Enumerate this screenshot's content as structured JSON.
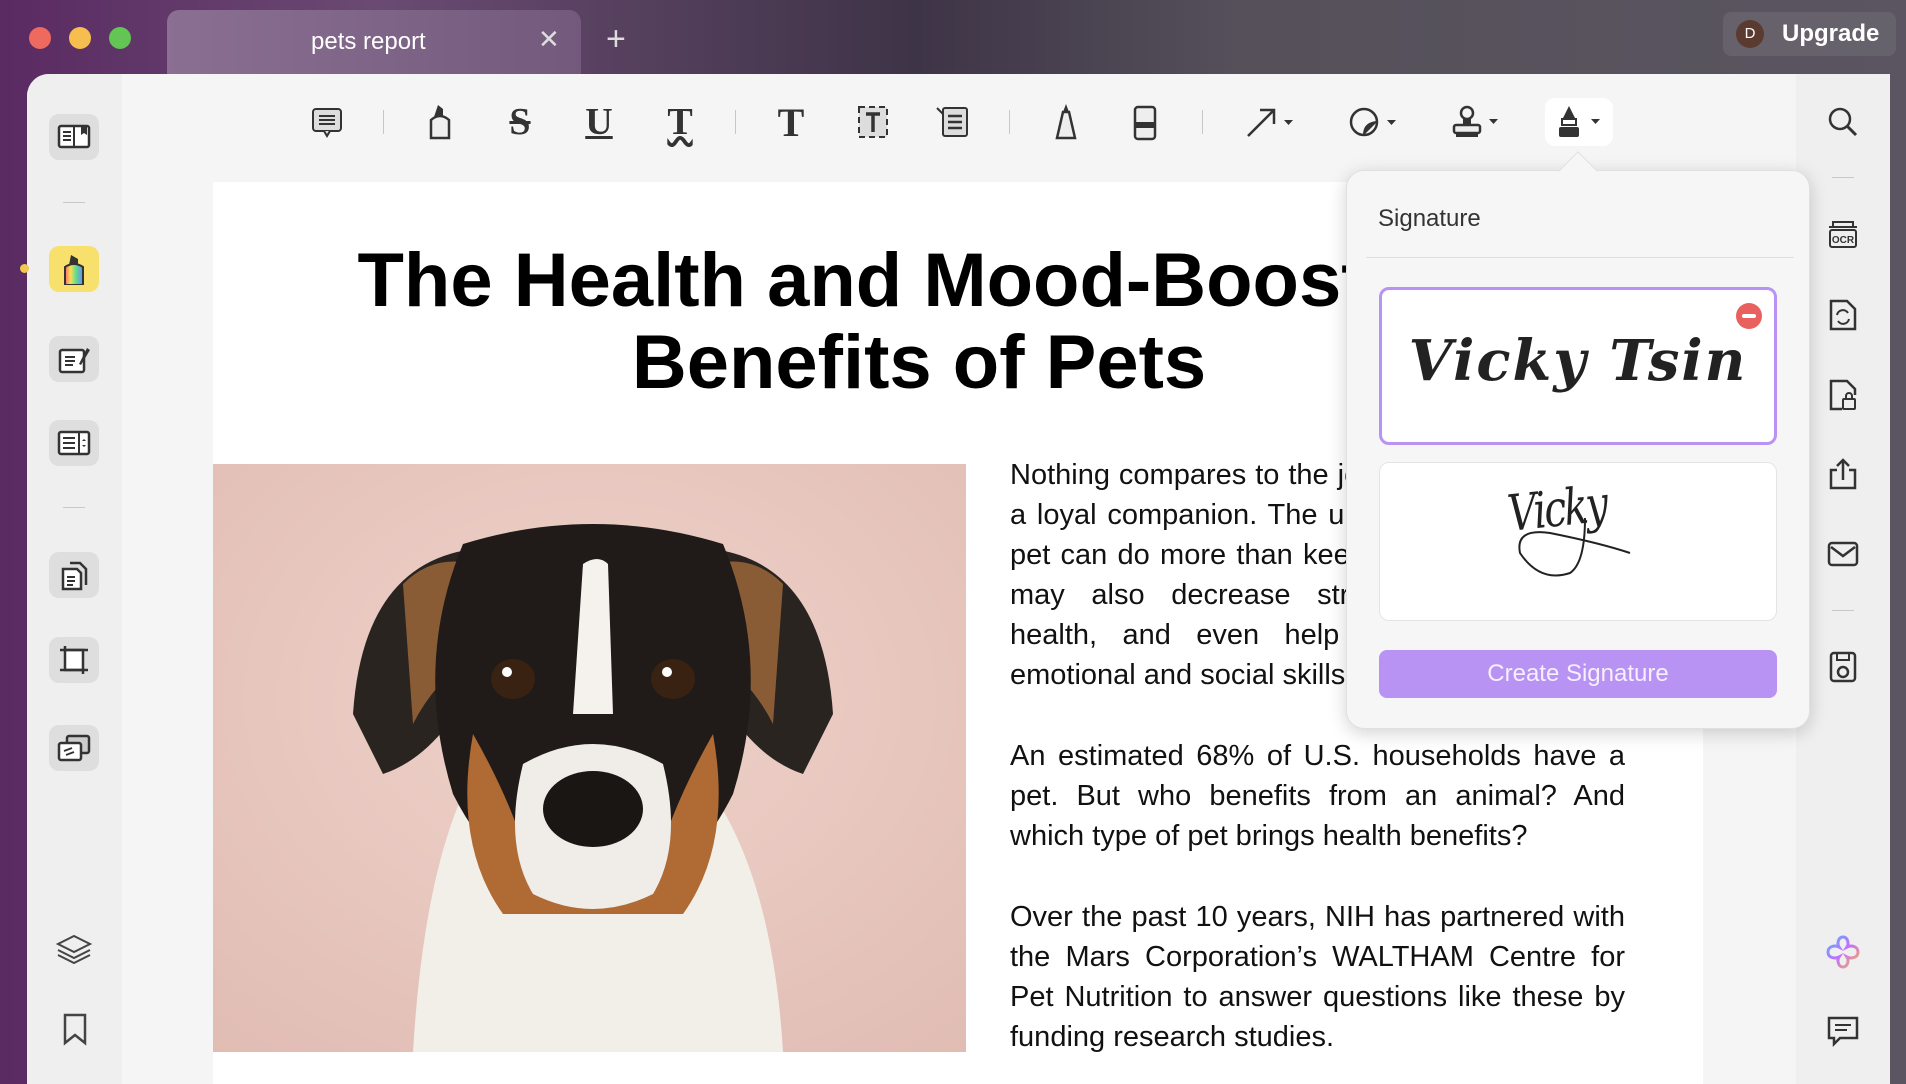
{
  "titlebar": {
    "tab_title": "pets report",
    "close_glyph": "✕",
    "new_tab_glyph": "+",
    "avatar_initial": "D",
    "upgrade_label": "Upgrade",
    "traffic_lights": [
      "#ee6a5f",
      "#f5be4f",
      "#62c554"
    ]
  },
  "toolbar": {
    "tools": [
      "comment-icon",
      "highlighter-icon",
      "strikethrough-icon",
      "underline-icon",
      "squiggly-underline-icon",
      "text-icon",
      "textbox-icon",
      "text-callout-icon",
      "pencil-icon",
      "eraser-icon",
      "arrow-icon",
      "shape-icon",
      "stamp-icon",
      "signature-pen-icon"
    ]
  },
  "document": {
    "title_line1": "The Health and Mood-Boosting",
    "title_line2": "Benefits of Pets",
    "para1": "Nothing compares to the joy of coming home to a loyal companion. The unconditional love of a pet can do more than keep you company. Pets may also decrease stress, improve heart health, and even help children with their emotional and social skills.",
    "para2": "An estimated 68% of U.S. households have a pet. But who benefits from an animal? And which type of pet brings health benefits?",
    "para3": "Over the past 10 years, NIH has partnered with the Mars Corporation’s WALTHAM Centre for Pet Nutrition to answer questions like these by funding research studies."
  },
  "signature_popup": {
    "title": "Signature",
    "signature1": "Vicky Tsin",
    "signature2": "Vicky",
    "create_label": "Create Signature",
    "accent": "#b893f3",
    "delete_color": "#e8615f"
  }
}
